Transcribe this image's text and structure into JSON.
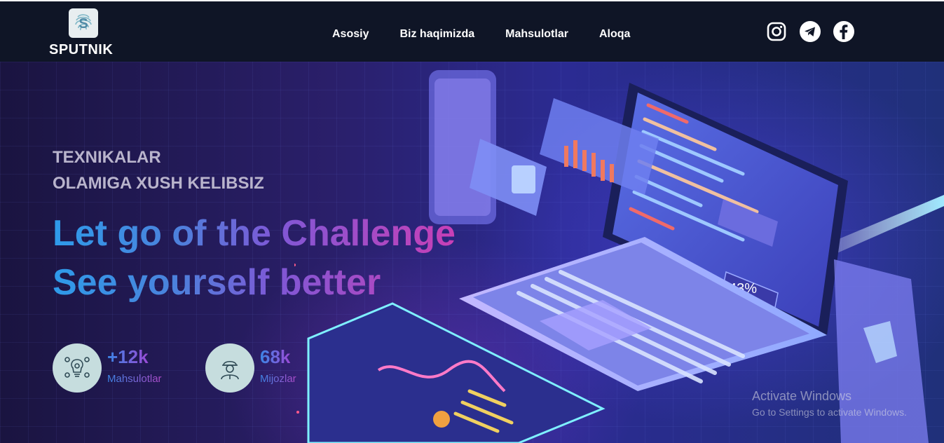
{
  "brand": {
    "name": "SPUTNIK",
    "logo_icon": "fingerprint-s-icon"
  },
  "nav": {
    "items": [
      "Asosiy",
      "Biz haqimizda",
      "Mahsulotlar",
      "Aloqa"
    ]
  },
  "social": [
    "instagram-icon",
    "telegram-icon",
    "facebook-icon"
  ],
  "hero": {
    "subtitle_line1": "TEXNIKALAR",
    "subtitle_line2": "OLAMIGA XUSH KELIBSIZ",
    "headline_line1": "Let go of the Challenge",
    "headline_line2": "See yourself better",
    "illustration_badge": "43%",
    "stats": [
      {
        "value": "+12k",
        "label": "Mahsulotlar",
        "icon": "idea-gears-icon"
      },
      {
        "value": "68k",
        "label": "Mijozlar",
        "icon": "engineer-person-icon"
      }
    ]
  },
  "watermark": {
    "title": "Activate Windows",
    "subtitle": "Go to Settings to activate Windows."
  },
  "colors": {
    "header_bg": "#0f1526",
    "accent_blue": "#2e9bea",
    "accent_purple": "#7e58d6",
    "accent_pink": "#c93fb6",
    "stat_circle": "#c6ddde"
  }
}
